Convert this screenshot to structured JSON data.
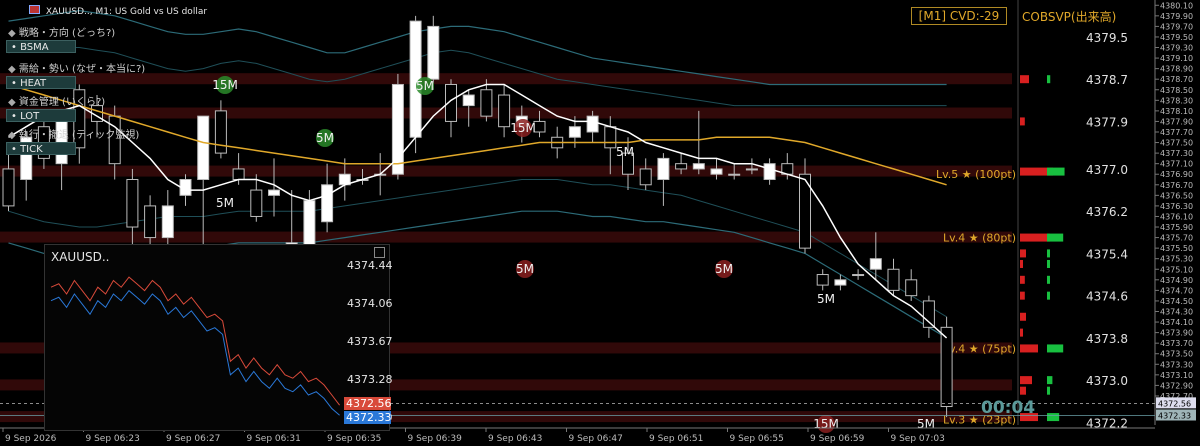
{
  "window": {
    "symbol_title": "XAUUSD.., M1:  US Gold vs US dollar",
    "cvd_label": "[M1] CVD:-29",
    "cobsvp_label": "COBSVP(出来高)",
    "countdown": "00:04"
  },
  "side_panel": {
    "rows": [
      {
        "icon": "gear-icon",
        "label": "戦略・方向 (どっち?)",
        "button": "BSMA"
      },
      {
        "icon": "flame-icon",
        "label": "需給・勢い (なぜ・本当に?)",
        "button": "HEAT"
      },
      {
        "icon": "scales-icon",
        "label": "資金管理 (いくら?)",
        "button": "LOT"
      },
      {
        "icon": "crosshair-icon",
        "label": "執行・撤退 (ティック監視)",
        "button": "TICK"
      }
    ]
  },
  "levels": [
    {
      "label": "Lv.5 ★ (100pt)",
      "price": 4376.9
    },
    {
      "label": "Lv.4 ★ (80pt)",
      "price": 4375.7
    },
    {
      "label": "Lv.4 ★ (75pt)",
      "price": 4373.6
    },
    {
      "label": "Lv.3 ★ (23pt)",
      "price": 4372.25
    }
  ],
  "timeframe_markers": [
    "15M",
    "5M",
    "5M",
    "5M",
    "15M",
    "5M",
    "5M",
    "5M",
    "5M",
    "15M",
    "5M"
  ],
  "mini_chart": {
    "title": "XAUUSD..",
    "prices": [
      "4374.44",
      "4374.06",
      "4373.67",
      "4373.28",
      "4372.90"
    ],
    "bid_tag": "4372.56",
    "ask_tag": "4372.33",
    "bid_color": "#d84a3a",
    "ask_color": "#2a78d8",
    "series": [
      {
        "values": [
          4374.2,
          4374.25,
          4374.1,
          4374.3,
          4374.15,
          4374.0,
          4374.2,
          4374.1,
          4374.3,
          4374.2,
          4374.35,
          4374.25,
          4374.15,
          4374.3,
          4374.2,
          4374.0,
          4374.1,
          4373.95,
          4374.05,
          4373.9,
          4373.75,
          4373.8,
          4373.7,
          4373.1,
          4373.2,
          4373.0,
          4373.15,
          4373.0,
          4372.9,
          4373.05,
          4372.9,
          4372.85,
          4372.95,
          4372.8,
          4372.85,
          4372.75,
          4372.6,
          4372.45
        ]
      },
      {
        "values": [
          4374.0,
          4374.05,
          4373.9,
          4374.1,
          4373.95,
          4373.8,
          4374.0,
          4373.9,
          4374.1,
          4374.0,
          4374.15,
          4374.05,
          4373.95,
          4374.1,
          4374.0,
          4373.8,
          4373.9,
          4373.75,
          4373.85,
          4373.7,
          4373.55,
          4373.6,
          4373.5,
          4372.9,
          4373.0,
          4372.8,
          4372.95,
          4372.8,
          4372.7,
          4372.85,
          4372.7,
          4372.65,
          4372.75,
          4372.6,
          4372.65,
          4372.55,
          4372.4,
          4372.3
        ]
      }
    ]
  },
  "chart_data": {
    "type": "candlestick",
    "title": "XAUUSD.., M1:  US Gold vs US dollar",
    "ylim": [
      4372.15,
      4380.2
    ],
    "y_ticks": [
      "4380.10",
      "4379.90",
      "4379.70",
      "4379.50",
      "4379.30",
      "4379.10",
      "4378.90",
      "4378.70",
      "4378.50",
      "4378.30",
      "4378.10",
      "4377.90",
      "4377.70",
      "4377.50",
      "4377.30",
      "4377.10",
      "4376.90",
      "4376.70",
      "4376.50",
      "4376.30",
      "4376.10",
      "4375.90",
      "4375.70",
      "4375.50",
      "4375.30",
      "4375.10",
      "4374.90",
      "4374.70",
      "4374.50",
      "4374.30",
      "4374.10",
      "4373.90",
      "4373.70",
      "4373.50",
      "4373.30",
      "4373.10",
      "4372.90",
      "4372.70"
    ],
    "big_ticks": [
      "4379.5",
      "4378.7",
      "4377.9",
      "4377.0",
      "4376.2",
      "4375.4",
      "4374.6",
      "4373.8",
      "4373.0",
      "4372.2"
    ],
    "price_tags": [
      {
        "value": "4372.56",
        "price": 4372.56
      },
      {
        "value": "4372.33",
        "price": 4372.33
      }
    ],
    "x_labels": [
      "9 Sep 2026",
      "9 Sep 06:23",
      "9 Sep 06:27",
      "9 Sep 06:31",
      "9 Sep 06:35",
      "9 Sep 06:39",
      "9 Sep 06:43",
      "9 Sep 06:47",
      "9 Sep 06:51",
      "9 Sep 06:55",
      "9 Sep 06:59",
      "9 Sep 07:03"
    ],
    "candles": [
      {
        "o": 4377.0,
        "h": 4377.4,
        "l": 4376.2,
        "c": 4376.3
      },
      {
        "o": 4376.8,
        "h": 4377.7,
        "l": 4376.4,
        "c": 4377.6
      },
      {
        "o": 4377.8,
        "h": 4378.0,
        "l": 4377.0,
        "c": 4377.2
      },
      {
        "o": 4377.1,
        "h": 4378.1,
        "l": 4376.6,
        "c": 4377.9
      },
      {
        "o": 4378.5,
        "h": 4378.6,
        "l": 4377.1,
        "c": 4377.4
      },
      {
        "o": 4378.2,
        "h": 4378.4,
        "l": 4377.6,
        "c": 4377.9
      },
      {
        "o": 4378.0,
        "h": 4378.2,
        "l": 4376.8,
        "c": 4377.1
      },
      {
        "o": 4376.8,
        "h": 4377.0,
        "l": 4375.5,
        "c": 4375.9
      },
      {
        "o": 4376.3,
        "h": 4376.5,
        "l": 4375.3,
        "c": 4375.7
      },
      {
        "o": 4375.7,
        "h": 4376.6,
        "l": 4375.4,
        "c": 4376.3
      },
      {
        "o": 4376.5,
        "h": 4376.9,
        "l": 4376.3,
        "c": 4376.8
      },
      {
        "o": 4376.8,
        "h": 4377.3,
        "l": 4375.3,
        "c": 4378.0
      },
      {
        "o": 4378.1,
        "h": 4378.3,
        "l": 4377.2,
        "c": 4377.3
      },
      {
        "o": 4377.0,
        "h": 4377.3,
        "l": 4376.7,
        "c": 4376.8
      },
      {
        "o": 4376.6,
        "h": 4376.9,
        "l": 4376.0,
        "c": 4376.1
      },
      {
        "o": 4376.5,
        "h": 4377.2,
        "l": 4376.1,
        "c": 4376.6
      },
      {
        "o": 4375.5,
        "h": 4376.6,
        "l": 4375.3,
        "c": 4375.6
      },
      {
        "o": 4375.5,
        "h": 4376.6,
        "l": 4375.3,
        "c": 4376.4
      },
      {
        "o": 4376.0,
        "h": 4377.1,
        "l": 4375.8,
        "c": 4376.7
      },
      {
        "o": 4376.7,
        "h": 4377.2,
        "l": 4376.4,
        "c": 4376.9
      },
      {
        "o": 4376.8,
        "h": 4377.0,
        "l": 4376.7,
        "c": 4376.8
      },
      {
        "o": 4376.9,
        "h": 4377.3,
        "l": 4376.5,
        "c": 4376.9
      },
      {
        "o": 4376.9,
        "h": 4378.8,
        "l": 4376.8,
        "c": 4378.6
      },
      {
        "o": 4377.6,
        "h": 4379.9,
        "l": 4377.3,
        "c": 4379.8
      },
      {
        "o": 4378.7,
        "h": 4379.9,
        "l": 4378.5,
        "c": 4379.7
      },
      {
        "o": 4378.6,
        "h": 4378.7,
        "l": 4377.6,
        "c": 4377.9
      },
      {
        "o": 4378.2,
        "h": 4378.5,
        "l": 4377.8,
        "c": 4378.4
      },
      {
        "o": 4378.5,
        "h": 4378.7,
        "l": 4377.9,
        "c": 4378.0
      },
      {
        "o": 4378.4,
        "h": 4378.6,
        "l": 4377.6,
        "c": 4377.8
      },
      {
        "o": 4377.8,
        "h": 4378.2,
        "l": 4377.5,
        "c": 4378.0
      },
      {
        "o": 4377.9,
        "h": 4378.1,
        "l": 4377.6,
        "c": 4377.7
      },
      {
        "o": 4377.6,
        "h": 4377.8,
        "l": 4377.2,
        "c": 4377.4
      },
      {
        "o": 4377.6,
        "h": 4378.0,
        "l": 4377.4,
        "c": 4377.8
      },
      {
        "o": 4377.7,
        "h": 4378.1,
        "l": 4377.5,
        "c": 4378.0
      },
      {
        "o": 4377.8,
        "h": 4378.0,
        "l": 4376.9,
        "c": 4377.4
      },
      {
        "o": 4377.3,
        "h": 4377.6,
        "l": 4376.6,
        "c": 4376.9
      },
      {
        "o": 4377.0,
        "h": 4377.2,
        "l": 4376.6,
        "c": 4376.7
      },
      {
        "o": 4376.8,
        "h": 4377.3,
        "l": 4376.3,
        "c": 4377.2
      },
      {
        "o": 4377.1,
        "h": 4377.3,
        "l": 4376.9,
        "c": 4377.0
      },
      {
        "o": 4377.0,
        "h": 4378.1,
        "l": 4376.9,
        "c": 4377.1
      },
      {
        "o": 4376.9,
        "h": 4377.2,
        "l": 4376.8,
        "c": 4377.0
      },
      {
        "o": 4376.9,
        "h": 4377.1,
        "l": 4376.8,
        "c": 4376.9
      },
      {
        "o": 4377.0,
        "h": 4377.2,
        "l": 4376.9,
        "c": 4377.0
      },
      {
        "o": 4376.8,
        "h": 4377.2,
        "l": 4376.7,
        "c": 4377.1
      },
      {
        "o": 4377.1,
        "h": 4377.3,
        "l": 4376.8,
        "c": 4376.9
      },
      {
        "o": 4376.9,
        "h": 4377.2,
        "l": 4375.4,
        "c": 4375.5
      },
      {
        "o": 4375.0,
        "h": 4375.1,
        "l": 4374.7,
        "c": 4374.8
      },
      {
        "o": 4374.8,
        "h": 4375.0,
        "l": 4374.7,
        "c": 4374.9
      },
      {
        "o": 4375.0,
        "h": 4375.1,
        "l": 4374.9,
        "c": 4375.0
      },
      {
        "o": 4375.1,
        "h": 4375.8,
        "l": 4374.9,
        "c": 4375.3
      },
      {
        "o": 4375.1,
        "h": 4375.3,
        "l": 4374.6,
        "c": 4374.7
      },
      {
        "o": 4374.9,
        "h": 4375.1,
        "l": 4374.5,
        "c": 4374.6
      },
      {
        "o": 4374.5,
        "h": 4374.6,
        "l": 4373.8,
        "c": 4374.0
      },
      {
        "o": 4374.0,
        "h": 4374.2,
        "l": 4372.3,
        "c": 4372.5
      }
    ],
    "ma_slow": [
      4378.6,
      4378.5,
      4378.4,
      4378.3,
      4378.2,
      4378.1,
      4378.0,
      4377.9,
      4377.8,
      4377.7,
      4377.6,
      4377.5,
      4377.45,
      4377.4,
      4377.35,
      4377.3,
      4377.25,
      4377.2,
      4377.15,
      4377.1,
      4377.1,
      4377.1,
      4377.1,
      4377.15,
      4377.2,
      4377.25,
      4377.3,
      4377.35,
      4377.4,
      4377.45,
      4377.5,
      4377.5,
      4377.5,
      4377.5,
      4377.5,
      4377.5,
      4377.55,
      4377.55,
      4377.55,
      4377.55,
      4377.6,
      4377.6,
      4377.6,
      4377.6,
      4377.55,
      4377.5,
      4377.4,
      4377.3,
      4377.2,
      4377.1,
      4377.0,
      4376.9,
      4376.8,
      4376.7
    ],
    "ma_fast": [
      4377.6,
      4377.8,
      4378.0,
      4378.1,
      4378.2,
      4378.0,
      4377.8,
      4377.5,
      4377.2,
      4376.8,
      4376.6,
      4376.6,
      4376.7,
      4376.8,
      4376.8,
      4376.7,
      4376.5,
      4376.4,
      4376.5,
      4376.7,
      4376.8,
      4376.9,
      4377.2,
      4377.6,
      4378.0,
      4378.3,
      4378.5,
      4378.6,
      4378.6,
      4378.4,
      4378.2,
      4378.0,
      4377.9,
      4377.9,
      4377.8,
      4377.7,
      4377.5,
      4377.4,
      4377.3,
      4377.2,
      4377.2,
      4377.1,
      4377.1,
      4377.0,
      4376.9,
      4376.8,
      4376.3,
      4375.7,
      4375.2,
      4374.9,
      4374.6,
      4374.4,
      4374.1,
      4373.8
    ],
    "band_upper": [
      4379.8,
      4379.85,
      4379.9,
      4379.95,
      4380.0,
      4379.95,
      4379.9,
      4379.8,
      4379.7,
      4379.6,
      4379.55,
      4379.55,
      4379.6,
      4379.65,
      4379.6,
      4379.5,
      4379.4,
      4379.3,
      4379.2,
      4379.2,
      4379.3,
      4379.4,
      4379.5,
      4379.6,
      4379.65,
      4379.7,
      4379.7,
      4379.65,
      4379.6,
      4379.5,
      4379.4,
      4379.3,
      4379.2,
      4379.1,
      4379.05,
      4379.0,
      4378.95,
      4378.9,
      4378.85,
      4378.8,
      4378.75,
      4378.7,
      4378.65,
      4378.6,
      4378.6,
      4378.6,
      4378.6,
      4378.6,
      4378.6,
      4378.6,
      4378.6,
      4378.6,
      4378.6,
      4378.6
    ],
    "band_lower": [
      4375.6,
      4375.5,
      4375.4,
      4375.35,
      4375.3,
      4375.3,
      4375.35,
      4375.4,
      4375.45,
      4375.5,
      4375.5,
      4375.5,
      4375.55,
      4375.6,
      4375.6,
      4375.6,
      4375.6,
      4375.6,
      4375.65,
      4375.7,
      4375.75,
      4375.8,
      4375.85,
      4375.9,
      4375.95,
      4376.0,
      4376.05,
      4376.1,
      4376.15,
      4376.2,
      4376.2,
      4376.2,
      4376.15,
      4376.1,
      4376.1,
      4376.05,
      4376.0,
      4376.0,
      4375.95,
      4375.9,
      4375.85,
      4375.8,
      4375.7,
      4375.6,
      4375.5,
      4375.4,
      4375.2,
      4375.0,
      4374.8,
      4374.6,
      4374.4,
      4374.2,
      4374.0,
      4373.8
    ],
    "band_upper_inner": [
      4379.2,
      4379.25,
      4379.3,
      4379.3,
      4379.3,
      4379.25,
      4379.2,
      4379.1,
      4379.0,
      4378.9,
      4378.85,
      4378.9,
      4379.0,
      4379.05,
      4379.0,
      4378.9,
      4378.8,
      4378.7,
      4378.65,
      4378.7,
      4378.8,
      4378.9,
      4379.0,
      4379.1,
      4379.2,
      4379.25,
      4379.2,
      4379.1,
      4379.0,
      4378.9,
      4378.8,
      4378.7,
      4378.65,
      4378.6,
      4378.55,
      4378.5,
      4378.45,
      4378.4,
      4378.35,
      4378.3,
      4378.25,
      4378.2,
      4378.2,
      4378.2,
      4378.2,
      4378.2,
      4378.2,
      4378.2,
      4378.2,
      4378.2,
      4378.2,
      4378.2,
      4378.2,
      4378.2
    ],
    "band_lower_inner": [
      4376.2,
      4376.1,
      4376.0,
      4375.95,
      4375.9,
      4375.9,
      4375.95,
      4376.0,
      4376.05,
      4376.1,
      4376.1,
      4376.1,
      4376.15,
      4376.2,
      4376.2,
      4376.2,
      4376.2,
      4376.2,
      4376.25,
      4376.3,
      4376.35,
      4376.4,
      4376.45,
      4376.5,
      4376.55,
      4376.6,
      4376.65,
      4376.7,
      4376.75,
      4376.8,
      4376.8,
      4376.8,
      4376.75,
      4376.7,
      4376.7,
      4376.65,
      4376.6,
      4376.55,
      4376.5,
      4376.4,
      4376.3,
      4376.2,
      4376.1,
      4376.0,
      4375.9,
      4375.8,
      4375.6,
      4375.4,
      4375.2,
      4375.0,
      4374.8,
      4374.6,
      4374.4,
      4374.2
    ],
    "volume_profile": [
      {
        "price": 4378.7,
        "sell": 0.15,
        "buy": 0.12
      },
      {
        "price": 4377.9,
        "sell": 0.08,
        "buy": 0.0
      },
      {
        "price": 4376.95,
        "sell": 0.55,
        "buy": 0.65
      },
      {
        "price": 4375.7,
        "sell": 0.5,
        "buy": 0.6
      },
      {
        "price": 4375.4,
        "sell": 0.1,
        "buy": 0.1
      },
      {
        "price": 4375.2,
        "sell": 0.05,
        "buy": 0.05
      },
      {
        "price": 4374.9,
        "sell": 0.08,
        "buy": 0.08
      },
      {
        "price": 4374.6,
        "sell": 0.08,
        "buy": 0.1
      },
      {
        "price": 4374.2,
        "sell": 0.1,
        "buy": 0.0
      },
      {
        "price": 4373.9,
        "sell": 0.05,
        "buy": 0.0
      },
      {
        "price": 4373.6,
        "sell": 0.3,
        "buy": 0.6
      },
      {
        "price": 4373.0,
        "sell": 0.2,
        "buy": 0.2
      },
      {
        "price": 4372.8,
        "sell": 0.1,
        "buy": 0.1
      },
      {
        "price": 4372.3,
        "sell": 0.3,
        "buy": 0.45
      }
    ],
    "colors": {
      "bull_candle": "#ffffff",
      "bear_candle": "#000000",
      "ma_slow": "#e0a82a",
      "ma_fast": "#ffffff",
      "band": "#2c6b78",
      "level_band": "#5a1010",
      "profile_sell": "#d82020",
      "profile_buy": "#18c040"
    }
  }
}
